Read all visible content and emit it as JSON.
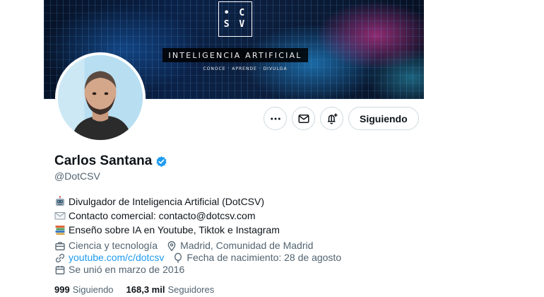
{
  "banner": {
    "logo_line1": "• C",
    "logo_line2": "S V",
    "title": "INTELIGENCIA ARTIFICIAL",
    "subtitle": "CONOCE · APRENDE · DIVULGA"
  },
  "actions": {
    "more_icon": "more-icon",
    "message_icon": "mail-icon",
    "notify_icon": "bell-plus-icon",
    "follow_label": "Siguiendo"
  },
  "profile": {
    "name": "Carlos Santana",
    "handle": "@DotCSV",
    "verified": true
  },
  "bio": [
    {
      "icon": "robot-emoji",
      "text": "Divulgador de Inteligencia Artificial (DotCSV)"
    },
    {
      "icon": "envelope-emoji",
      "text": "Contacto comercial: contacto@dotcsv.com"
    },
    {
      "icon": "books-emoji",
      "text": "Enseño sobre IA en Youtube, Tiktok e Instagram"
    }
  ],
  "meta": {
    "category": "Ciencia y tecnología",
    "location": "Madrid, Comunidad de Madrid",
    "website": "youtube.com/c/dotcsv",
    "birthday": "Fecha de nacimiento: 28 de agosto",
    "joined": "Se unió en marzo de 2016"
  },
  "stats": {
    "following_count": "999",
    "following_label": "Siguiendo",
    "followers_count": "168,3 mil",
    "followers_label": "Seguidores"
  },
  "colors": {
    "accent": "#1d9bf0",
    "text_primary": "#0f1419",
    "text_secondary": "#536471",
    "border": "#cfd9de"
  }
}
